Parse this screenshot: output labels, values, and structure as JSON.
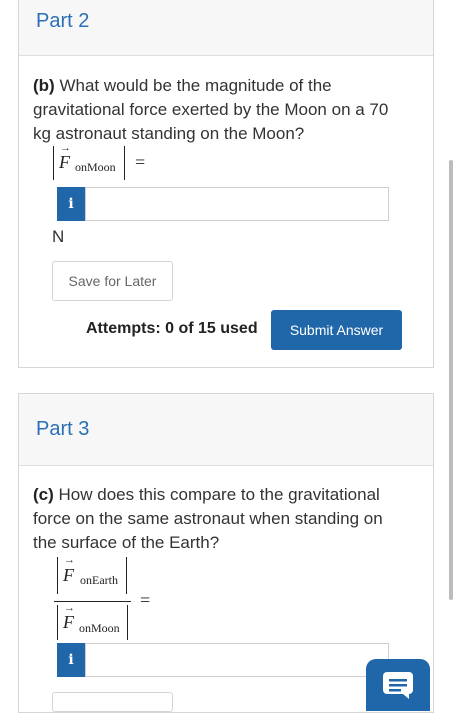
{
  "part2": {
    "header": "Part 2",
    "question_prefix": "(b)",
    "question_text": "What would be the magnitude of the gravitational force exerted by the Moon on a 70 kg astronaut standing on the Moon?",
    "vector_symbol": "F",
    "vector_subscript": "onMoon",
    "equals": "=",
    "info_label": "i",
    "unit": "N",
    "save_label": "Save for Later",
    "attempts_label": "Attempts: 0 of 15 used",
    "submit_label": "Submit Answer"
  },
  "part3": {
    "header": "Part 3",
    "question_prefix": "(c)",
    "question_text": "How does this compare to the gravitational force on the same astronaut when standing on the surface of the Earth?",
    "numerator_symbol": "F",
    "numerator_subscript": "onEarth",
    "denominator_symbol": "F",
    "denominator_subscript": "onMoon",
    "equals": "=",
    "info_label": "i"
  },
  "colors": {
    "accent": "#1f67a8",
    "header_text": "#2a6fb5",
    "header_bg": "#f7f7f7"
  },
  "icons": {
    "info": "info-icon",
    "chat": "chat-icon"
  }
}
